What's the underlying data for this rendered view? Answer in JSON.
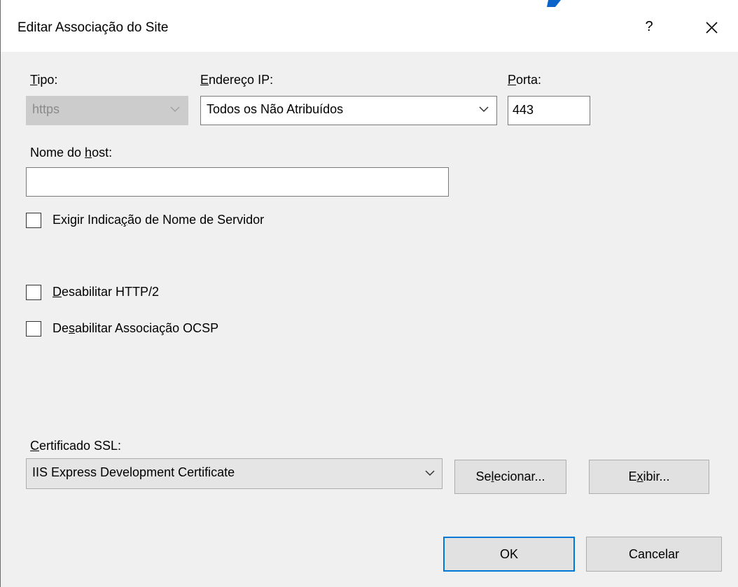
{
  "window": {
    "title": "Editar Associação do Site",
    "help_glyph": "?",
    "close_icon": "close-icon",
    "accent_color": "#0078d7"
  },
  "type": {
    "label_mnemonic": "T",
    "label_rest": "ipo:",
    "value": "https"
  },
  "ip": {
    "label_mnemonic": "E",
    "label_rest": "ndereço IP:",
    "value": "Todos os Não Atribuídos"
  },
  "port": {
    "label_mnemonic": "P",
    "label_rest": "orta:",
    "value": "443"
  },
  "hostname": {
    "label_before": "Nome do ",
    "label_mnemonic": "h",
    "label_after": "ost:",
    "value": ""
  },
  "checks": {
    "sni": {
      "before": "Exigir Indica",
      "mnemonic": "ç",
      "after": "ão de Nome de Servidor",
      "checked": false
    },
    "http2": {
      "before": "",
      "mnemonic": "D",
      "after": "esabilitar HTTP/2",
      "checked": false
    },
    "ocsp": {
      "before": "De",
      "mnemonic": "s",
      "after": "abilitar Associação OCSP",
      "checked": false
    }
  },
  "ssl": {
    "label_mnemonic": "C",
    "label_rest": "ertificado SSL:",
    "value": "IIS Express Development Certificate"
  },
  "buttons": {
    "select": {
      "before": "Se",
      "mnemonic": "l",
      "after": "ecionar..."
    },
    "view": {
      "before": "E",
      "mnemonic": "x",
      "after": "ibir..."
    },
    "ok": "OK",
    "cancel": "Cancelar"
  }
}
